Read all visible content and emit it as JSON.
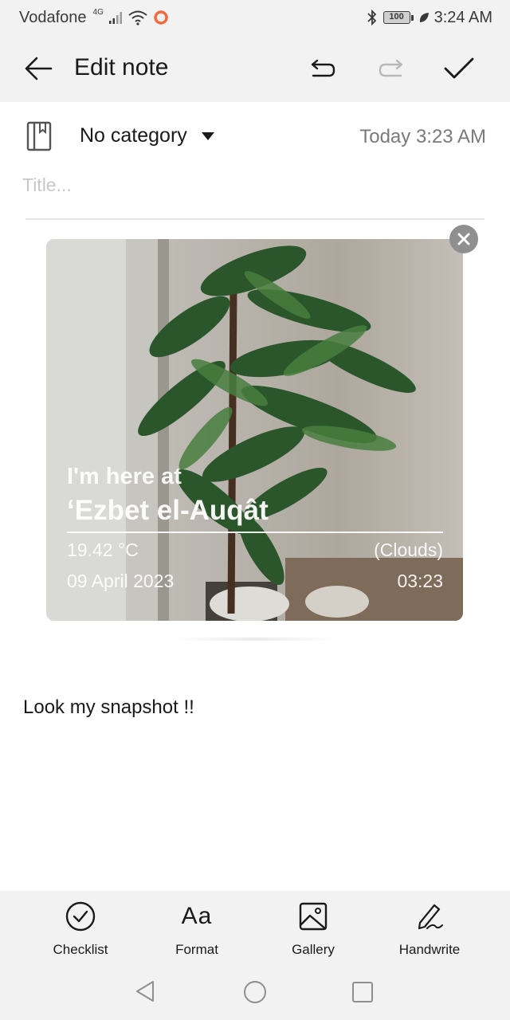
{
  "status_bar": {
    "carrier": "Vodafone",
    "network": "4G",
    "battery": "100",
    "time": "3:24 AM"
  },
  "app_bar": {
    "title": "Edit note",
    "icons": [
      "back-arrow-icon",
      "undo-icon",
      "redo-icon",
      "checkmark-icon"
    ]
  },
  "meta": {
    "category": "No category",
    "timestamp": "Today 3:23 AM"
  },
  "title_field": {
    "value": "",
    "placeholder": "Title..."
  },
  "snapshot": {
    "intro": "I'm here at",
    "place": "‘Ezbet el-Auqât",
    "temperature": "19.42 °C",
    "weather": "(Clouds)",
    "date": "09 April 2023",
    "time": "03:23"
  },
  "body": {
    "text": "Look my snapshot !!"
  },
  "toolbar": {
    "checklist": "Checklist",
    "format": "Format",
    "format_glyph": "Aa",
    "gallery": "Gallery",
    "handwrite": "Handwrite"
  },
  "colors": {
    "bar_background": "#f2f2f2",
    "text": "#1a1a1a",
    "muted": "#7a7a7a",
    "placeholder": "#c8c8c8"
  }
}
